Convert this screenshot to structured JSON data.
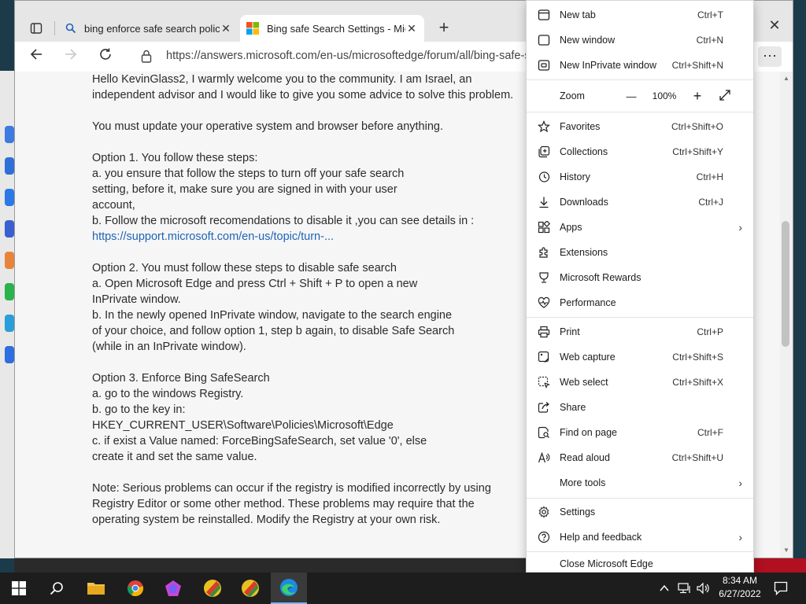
{
  "tabs": [
    {
      "title": "bing enforce safe search policy w",
      "icon": "search-icon",
      "active": false
    },
    {
      "title": "Bing safe Search Settings - Micro",
      "icon": "microsoft-logo-icon",
      "active": true
    }
  ],
  "address": {
    "url": "https://answers.microsoft.com/en-us/microsoftedge/forum/all/bing-safe-s"
  },
  "article": {
    "p1": "Hello KevinGlass2, I warmly welcome you to the community. I am Israel, an independent advisor and I would like to give you some advice to solve this problem.",
    "p2": "You must update your operative system and browser before anything.",
    "p3": "Option 1. You follow these steps:\na. you ensure that follow the steps to turn off your safe search\nsetting, before it, make sure you are signed in with your user\naccount,\nb. Follow the microsoft recomendations to disable it ,you can see details in :",
    "p3_link": "https://support.microsoft.com/en-us/topic/turn-...",
    "p4": "Option 2. You must follow these steps to disable safe search\na. Open Microsoft Edge and press Ctrl + Shift + P to open a new\nInPrivate window.\nb. In the newly opened InPrivate window, navigate to the search engine\nof your choice, and follow option 1, step b again, to disable Safe Search\n(while in an InPrivate window).",
    "p5": "Option 3. Enforce Bing SafeSearch\na. go to the windows Registry.\nb. go to the key in:\nHKEY_CURRENT_USER\\Software\\Policies\\Microsoft\\Edge\nc. if exist a Value named: ForceBingSafeSearch, set value '0', else\ncreate it and set the same value.",
    "p6": "Note: Serious problems can occur if the registry is modified incorrectly by using Registry Editor or some other method. These problems may require that the operating system be reinstalled. Modify the Registry at your own risk."
  },
  "menu": {
    "items": [
      {
        "label": "New tab",
        "shortcut": "Ctrl+T",
        "icon": "new-tab-icon"
      },
      {
        "label": "New window",
        "shortcut": "Ctrl+N",
        "icon": "new-window-icon"
      },
      {
        "label": "New InPrivate window",
        "shortcut": "Ctrl+Shift+N",
        "icon": "inprivate-icon"
      },
      {
        "label": "Favorites",
        "shortcut": "Ctrl+Shift+O",
        "icon": "favorites-icon"
      },
      {
        "label": "Collections",
        "shortcut": "Ctrl+Shift+Y",
        "icon": "collections-icon"
      },
      {
        "label": "History",
        "shortcut": "Ctrl+H",
        "icon": "history-icon"
      },
      {
        "label": "Downloads",
        "shortcut": "Ctrl+J",
        "icon": "downloads-icon"
      },
      {
        "label": "Apps",
        "shortcut": "",
        "icon": "apps-icon"
      },
      {
        "label": "Extensions",
        "shortcut": "",
        "icon": "extensions-icon"
      },
      {
        "label": "Microsoft Rewards",
        "shortcut": "",
        "icon": "rewards-icon"
      },
      {
        "label": "Performance",
        "shortcut": "",
        "icon": "performance-icon"
      },
      {
        "label": "Print",
        "shortcut": "Ctrl+P",
        "icon": "print-icon"
      },
      {
        "label": "Web capture",
        "shortcut": "Ctrl+Shift+S",
        "icon": "web-capture-icon"
      },
      {
        "label": "Web select",
        "shortcut": "Ctrl+Shift+X",
        "icon": "web-select-icon"
      },
      {
        "label": "Share",
        "shortcut": "",
        "icon": "share-icon"
      },
      {
        "label": "Find on page",
        "shortcut": "Ctrl+F",
        "icon": "find-icon"
      },
      {
        "label": "Read aloud",
        "shortcut": "Ctrl+Shift+U",
        "icon": "read-aloud-icon"
      },
      {
        "label": "More tools",
        "shortcut": "",
        "icon": "more-tools-icon"
      },
      {
        "label": "Settings",
        "shortcut": "",
        "icon": "settings-icon"
      },
      {
        "label": "Help and feedback",
        "shortcut": "",
        "icon": "help-icon"
      },
      {
        "label": "Close Microsoft Edge",
        "shortcut": "",
        "icon": ""
      }
    ],
    "zoom": {
      "label": "Zoom",
      "value": "100%",
      "minus": "—",
      "plus": "+"
    }
  },
  "taskbar": {
    "time": "8:34 AM",
    "date": "6/27/2022"
  },
  "colors": {
    "link": "#1f63b8",
    "taskbar": "#1d1d1d",
    "tab_bar": "#e6e6e6"
  }
}
